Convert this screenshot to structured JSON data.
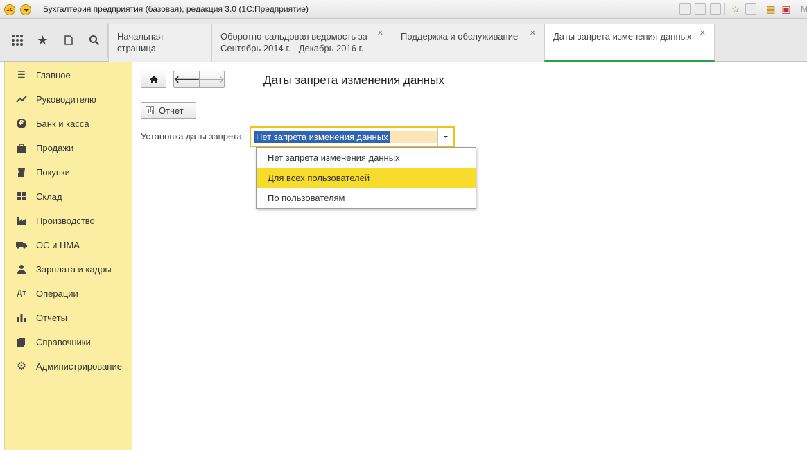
{
  "window": {
    "title": "Бухгалтерия предприятия (базовая), редакция 3.0  (1С:Предприятие)",
    "logo_text": "1С",
    "overflow_text": "M"
  },
  "tabs": [
    {
      "label": "Начальная страница",
      "closable": false,
      "active": false
    },
    {
      "label": "Оборотно-сальдовая ведомость за Сентябрь 2014 г. - Декабрь 2016 г.",
      "closable": true,
      "active": false
    },
    {
      "label": "Поддержка и обслуживание",
      "closable": true,
      "active": false
    },
    {
      "label": "Даты запрета изменения данных",
      "closable": true,
      "active": true
    }
  ],
  "sidebar": {
    "items": [
      {
        "label": "Главное",
        "icon": "menu-lines-icon"
      },
      {
        "label": "Руководителю",
        "icon": "trend-icon"
      },
      {
        "label": "Банк и касса",
        "icon": "ruble-icon"
      },
      {
        "label": "Продажи",
        "icon": "bag-icon"
      },
      {
        "label": "Покупки",
        "icon": "cart-icon"
      },
      {
        "label": "Склад",
        "icon": "warehouse-icon"
      },
      {
        "label": "Производство",
        "icon": "factory-icon"
      },
      {
        "label": "ОС и НМА",
        "icon": "truck-icon"
      },
      {
        "label": "Зарплата и кадры",
        "icon": "person-icon"
      },
      {
        "label": "Операции",
        "icon": "operations-icon"
      },
      {
        "label": "Отчеты",
        "icon": "bar-chart-icon"
      },
      {
        "label": "Справочники",
        "icon": "books-icon"
      },
      {
        "label": "Администрирование",
        "icon": "gear-icon"
      }
    ]
  },
  "main": {
    "title": "Даты запрета изменения данных",
    "report_button": "Отчет",
    "field_label": "Установка даты запрета:",
    "field_value": "Нет запрета изменения данных",
    "dropdown_options": [
      {
        "label": "Нет запрета изменения данных",
        "selected": false
      },
      {
        "label": "Для всех пользователей",
        "selected": true
      },
      {
        "label": "По пользователям",
        "selected": false
      }
    ]
  },
  "colors": {
    "sidebar_bg": "#fbeea2",
    "accent_yellow": "#f8dc2b",
    "active_tab_underline": "#2aa04a",
    "selection_blue": "#3165b3"
  }
}
